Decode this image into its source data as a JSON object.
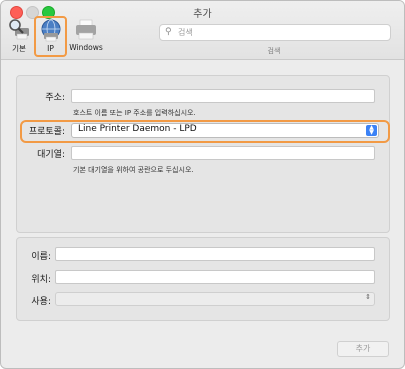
{
  "window": {
    "title": "추가"
  },
  "toolbar": {
    "basic_label": "기본",
    "ip_label": "IP",
    "windows_label": "Windows",
    "search_placeholder": "검색",
    "search_caption": "검색"
  },
  "form": {
    "address_label": "주소:",
    "address_value": "",
    "address_hint": "호스트 이름 또는 IP 주소를 입력하십시오.",
    "protocol_label": "프로토콜:",
    "protocol_value": "Line Printer Daemon - LPD",
    "queue_label": "대기열:",
    "queue_value": "",
    "queue_hint": "기본 대기열을 위하여 공란으로 두십시오."
  },
  "details": {
    "name_label": "이름:",
    "name_value": "",
    "location_label": "위치:",
    "location_value": "",
    "use_label": "사용:",
    "use_value": ""
  },
  "footer": {
    "add_label": "추가"
  },
  "colors": {
    "highlight": "#f29a45",
    "accent": "#3b82f6"
  }
}
